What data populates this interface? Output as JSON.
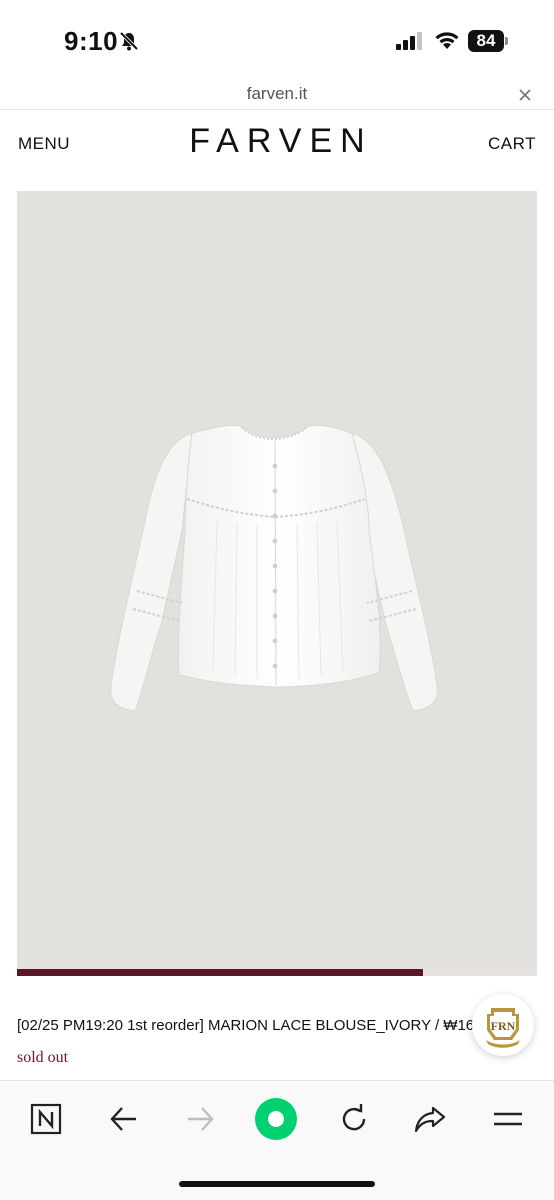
{
  "status_bar": {
    "time": "9:10",
    "battery": "84",
    "icons": [
      "bell-slash-icon",
      "cellular-signal-icon",
      "wifi-icon",
      "battery-icon"
    ]
  },
  "browser": {
    "url": "farven.it",
    "close_icon": "close-icon"
  },
  "header": {
    "menu_label": "MENU",
    "brand": "FARVEN",
    "cart_label": "CART"
  },
  "product": {
    "title": "[02/25 PM19:20 1st reorder] MARION LACE BLOUSE_IVORY / ₩160,000",
    "status": "sold out",
    "carousel_progress": 0.78,
    "image_background": "#e3e1de"
  },
  "floating_badge": {
    "icon": "farven-seal-icon"
  },
  "toolbar": {
    "buttons": [
      "naver-home-icon",
      "back-arrow-icon",
      "forward-arrow-icon",
      "green-dot-icon",
      "reload-icon",
      "share-icon",
      "hamburger-menu-icon"
    ],
    "accent_color": "#00d070",
    "progress_color": "#5a1622"
  }
}
